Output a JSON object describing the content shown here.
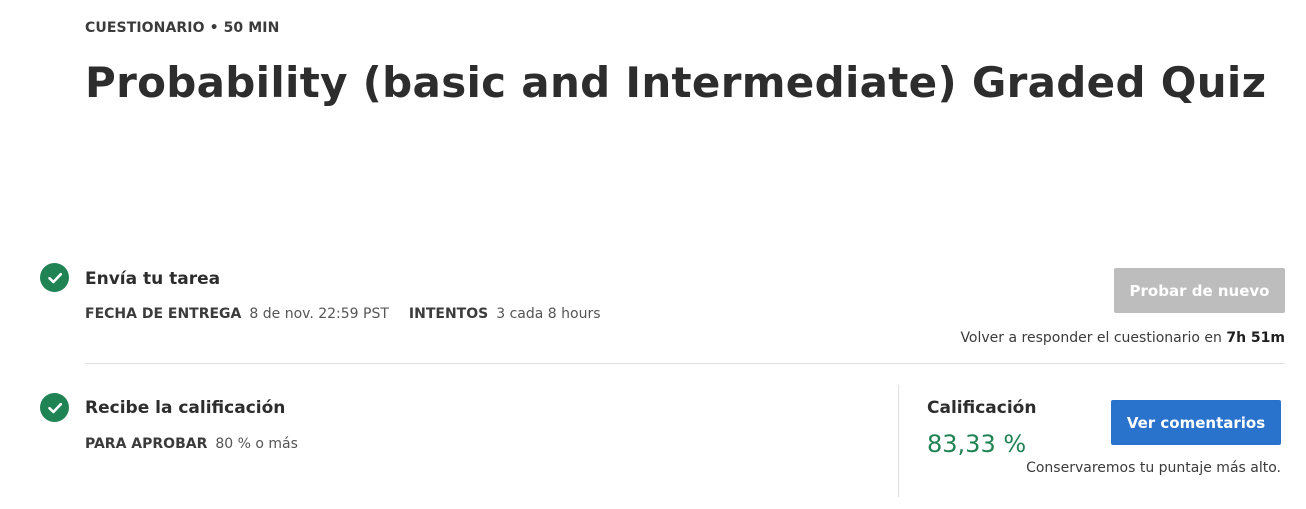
{
  "header": {
    "eyebrow": "CUESTIONARIO • 50 MIN",
    "title": "Probability (basic and Intermediate) Graded Quiz"
  },
  "submit_step": {
    "title": "Envía tu tarea",
    "due_label": "FECHA DE ENTREGA",
    "due_value": "8 de nov. 22:59 PST",
    "attempts_label": "INTENTOS",
    "attempts_value": "3 cada 8 hours",
    "retry_button": "Probar de nuevo",
    "retry_note_prefix": "Volver a responder el cuestionario en",
    "retry_time": "7h 51m"
  },
  "grade_step": {
    "title": "Recibe la calificación",
    "pass_label": "PARA APROBAR",
    "pass_value": "80 % o más",
    "grade_label": "Calificación",
    "grade_value": "83,33 %",
    "feedback_button": "Ver comentarios",
    "keep_note": "Conservaremos tu puntaje más alto."
  },
  "colors": {
    "success": "#1f8354",
    "primary_button": "#2a73cc",
    "disabled_button": "#bdbdbd"
  },
  "icons": {
    "step_status": "check-circle-icon"
  }
}
